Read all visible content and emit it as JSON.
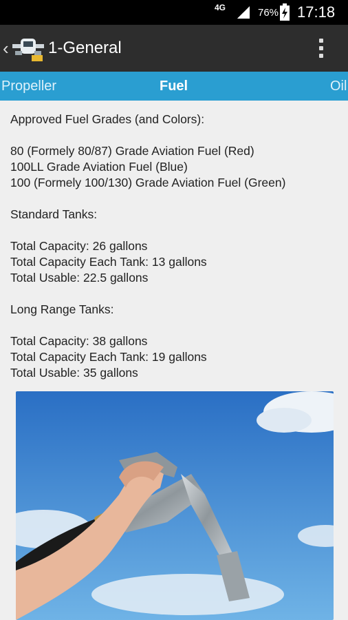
{
  "status_bar": {
    "network": "4G",
    "battery_percent": "76%",
    "time": "17:18"
  },
  "app_bar": {
    "title": "1-General",
    "logo_icon": "airplane-logo-icon",
    "menu_icon": "overflow-menu-icon"
  },
  "tabs": [
    {
      "label": "Propeller",
      "selected": false
    },
    {
      "label": "Fuel",
      "selected": true
    },
    {
      "label": "Oil",
      "selected": false
    }
  ],
  "content": {
    "approved_heading": "Approved Fuel Grades (and Colors):",
    "grades": [
      "80 (Formely 80/87) Grade Aviation Fuel (Red)",
      "100LL Grade Aviation Fuel (Blue)",
      "100 (Formely 100/130) Grade Aviation Fuel (Green)"
    ],
    "standard_heading": "Standard Tanks:",
    "standard": [
      "Total Capacity: 26 gallons",
      "Total Capacity Each Tank: 13 gallons",
      "Total Usable: 22.5 gallons"
    ],
    "long_range_heading": "Long Range Tanks:",
    "long_range": [
      "Total Capacity: 38 gallons",
      "Total Capacity Each Tank: 19 gallons",
      "Total Usable: 35 gallons"
    ]
  },
  "colors": {
    "tab_bar": "#2a9ed1",
    "app_bar": "#2d2d2d",
    "background": "#efefef"
  }
}
